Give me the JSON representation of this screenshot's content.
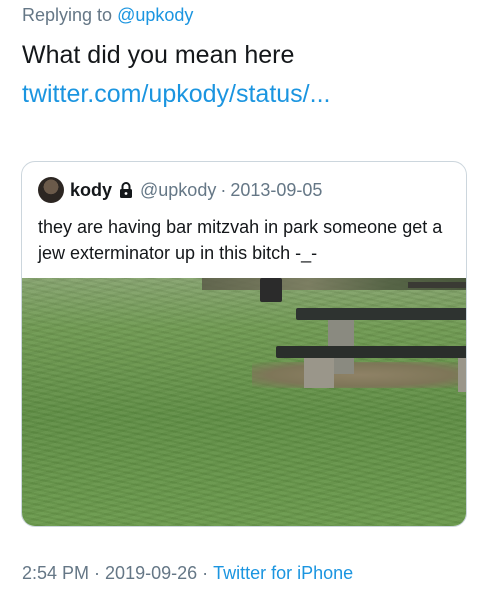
{
  "reply": {
    "prefix": "Replying to",
    "handle": "@upkody"
  },
  "tweet": {
    "text": "What did you mean here ",
    "link_text": "twitter.com/upkody/status/..."
  },
  "quote": {
    "name": "kody",
    "handle": "@upkody",
    "separator": "·",
    "date": "2013-09-05",
    "text": "they are having bar mitzvah in park someone get a jew exterminator up in this bitch -_-",
    "protected_icon": "lock-icon",
    "media_description_icon": "photo"
  },
  "footer": {
    "time": "2:54 PM",
    "separator": "·",
    "date": "2019-09-26",
    "separator2": "·",
    "source": "Twitter for iPhone"
  },
  "colors": {
    "link": "#1b95e0",
    "secondary": "#657786",
    "text": "#14171a",
    "border": "#ccd6dd"
  }
}
